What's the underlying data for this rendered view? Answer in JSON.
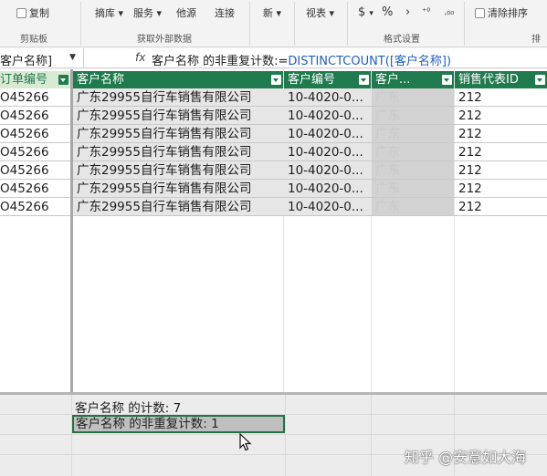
{
  "ribbon": {
    "copy_label": "复制",
    "clipboard_label": "剪贴板",
    "from_db_label": "摘库",
    "service_label": "服务",
    "other_label": "他源",
    "connection_label": "连接",
    "external_group_label": "获取外部数据",
    "new_label": "新",
    "view_label": "视表",
    "currency_symbol": "$",
    "percent_symbol": "%",
    "comma_symbol": "›",
    "format_group_label": "格式设置",
    "clear_sort_label": "清除排序",
    "sort_group_label": "排"
  },
  "formula_bar": {
    "name_box": "客户名称]",
    "fx_label": "fx",
    "formula_prefix": "客户名称 的非重复计数:=",
    "formula_function": "DISTINCTCOUNT([客户名称])"
  },
  "table": {
    "columns": [
      "订单编号",
      "客户名称",
      "客户编号",
      "客户...",
      "销售代表ID"
    ],
    "rows": [
      [
        "O45266",
        "广东29955自行车销售有限公司",
        "10-4020-0...",
        "广东",
        "212"
      ],
      [
        "O45266",
        "广东29955自行车销售有限公司",
        "10-4020-0...",
        "广东",
        "212"
      ],
      [
        "O45266",
        "广东29955自行车销售有限公司",
        "10-4020-0...",
        "广东",
        "212"
      ],
      [
        "O45266",
        "广东29955自行车销售有限公司",
        "10-4020-0...",
        "广东",
        "212"
      ],
      [
        "O45266",
        "广东29955自行车销售有限公司",
        "10-4020-0...",
        "广东",
        "212"
      ],
      [
        "O45266",
        "广东29955自行车销售有限公司",
        "10-4020-0...",
        "广东",
        "212"
      ],
      [
        "O45266",
        "广东29955自行车销售有限公司",
        "10-4020-0...",
        "广东",
        "212"
      ]
    ]
  },
  "calc_area": {
    "count_measure": "客户名称 的计数: 7",
    "distinct_measure": "客户名称 的非重复计数: 1"
  },
  "watermark": "知乎 @安意如大海"
}
